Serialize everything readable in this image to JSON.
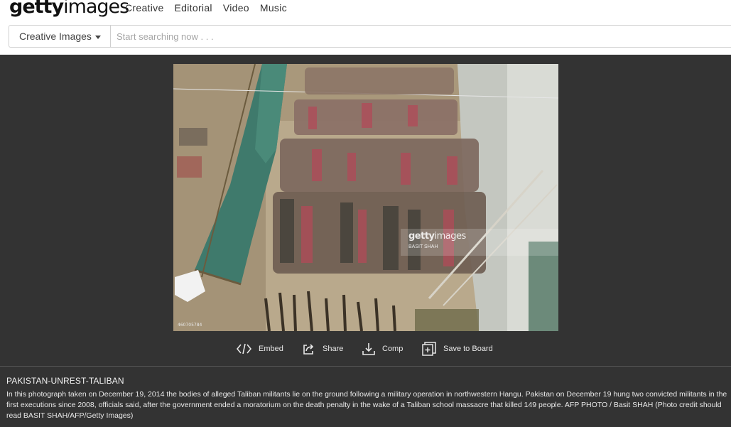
{
  "header": {
    "logo_bold": "getty",
    "logo_light": "images",
    "nav": [
      "Creative",
      "Editorial",
      "Video",
      "Music"
    ]
  },
  "search": {
    "category": "Creative Images",
    "placeholder": "Start searching now . . ."
  },
  "photo": {
    "id": "460705784",
    "watermark_bold": "getty",
    "watermark_light": "images",
    "watermark_credit": "BASIT SHAH"
  },
  "actions": {
    "embed": "Embed",
    "share": "Share",
    "comp": "Comp",
    "board": "Save to Board"
  },
  "caption": {
    "title": "PAKISTAN-UNREST-TALIBAN",
    "body": "In this photograph taken on December 19, 2014 the bodies of alleged Taliban militants lie on the ground following a military operation in northwestern Hangu. Pakistan on December 19 hung two convicted militants in the first executions since 2008, officials said, after the government ended a moratorium on the death penalty in the wake of a Taliban school massacre that killed 149 people. AFP PHOTO / Basit SHAH (Photo credit should read BASIT SHAH/AFP/Getty Images)"
  },
  "colors": {
    "viewer_bg": "#333333",
    "header_bg": "#ffffff",
    "accent_text": "#e8e8e8"
  },
  "icons": {
    "embed": "code-icon",
    "share": "share-arrow-icon",
    "comp": "download-icon",
    "board": "add-board-icon",
    "category_caret": "caret-down-icon"
  }
}
